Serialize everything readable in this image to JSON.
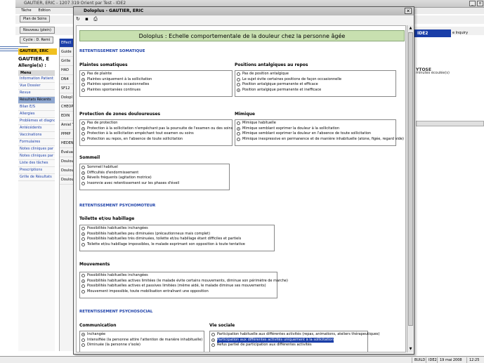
{
  "app": {
    "title": "GAUTIER, ERIC - 1207 319 Orient par Test - IDE2",
    "menu": [
      "Tâche",
      "Edition"
    ],
    "toolbar": {
      "plan_soins": "Plan de Soins",
      "nouveau": "Nouveau (plein)",
      "cycle": "Cycle : D. Remi"
    },
    "patient_bar": "GAUTIER, ERIC",
    "patient_name": "GAUTIER, E",
    "allergy": "Allergie(s) : ",
    "right_tab": "IDE2",
    "right_inquiry": "e Inquiry",
    "right_text1": "YTOSE",
    "right_text2": "minutes écoulée(s)"
  },
  "menu": {
    "title": "Menu",
    "items": [
      {
        "label": "Information Patient",
        "selected": false
      },
      {
        "label": "Vue Dossier",
        "selected": false
      },
      {
        "label": "Revue",
        "selected": false
      },
      {
        "label": "Résultats Récents",
        "selected": true
      },
      {
        "label": "Bilan E/S",
        "selected": false
      },
      {
        "label": "Allergies",
        "selected": false
      },
      {
        "label": "Problèmes et diagno",
        "selected": false
      },
      {
        "label": "Antécédents",
        "selected": false
      },
      {
        "label": "Vaccinations",
        "selected": false
      },
      {
        "label": "Formulaires",
        "selected": false
      },
      {
        "label": "Notes cliniques par",
        "selected": false
      },
      {
        "label": "Notes cliniques par t",
        "selected": false
      },
      {
        "label": "Liste des tâches",
        "selected": false
      },
      {
        "label": "Prescriptions",
        "selected": false
      },
      {
        "label": "Grille de Résultats",
        "selected": false
      }
    ]
  },
  "doc_list": [
    "Effect",
    "Guide",
    "Grille",
    "HAD",
    "DN4",
    "SF12",
    "Dolopl",
    "CHEOP",
    "EDIN",
    "Amiel T",
    "PPMP",
    "HEDEN",
    "Évalua",
    "Doulou",
    "Doulou",
    "Doulou"
  ],
  "dialog": {
    "title": "Doloplus - GAUTIER, ERIC",
    "banner": "Doloplus : Echelle comportementale de la douleur chez la personne âgée",
    "sections": {
      "somatique": "RETENTISSEMENT SOMATIQUE",
      "psychomoteur": "RETENTISSEMENT PSYCHOMOTEUR",
      "psychosocial": "RETENTISSEMENT PSYCHOSOCIAL"
    },
    "groups": {
      "plaintes": {
        "title": "Plaintes somatiques",
        "options": [
          {
            "label": "Pas de plainte",
            "selected": false
          },
          {
            "label": "Plaintes uniquement à la sollicitation",
            "selected": true
          },
          {
            "label": "Plaintes spontanées occasionnelles",
            "selected": false
          },
          {
            "label": "Plaintes spontanées continues",
            "selected": false
          }
        ]
      },
      "positions": {
        "title": "Positions antalgiques au repos",
        "options": [
          {
            "label": "Pas de position antalgique",
            "selected": false
          },
          {
            "label": "Le sujet évite certaines positions de façon occasionnelle",
            "selected": false
          },
          {
            "label": "Position antalgique permanente et efficace",
            "selected": false
          },
          {
            "label": "Position antalgique permanente et inefficace",
            "selected": true
          }
        ]
      },
      "protection": {
        "title": "Protection de zones douloureuses",
        "options": [
          {
            "label": "Pas de protection",
            "selected": false
          },
          {
            "label": "Protection à la sollicitation n'empêchant pas la poursuite de l'examen ou des soins",
            "selected": true
          },
          {
            "label": "Protection à la sollicitation empêchant tout examen ou soins",
            "selected": false
          },
          {
            "label": "Protection au repos, en l'absence de toute sollicitation",
            "selected": false
          }
        ]
      },
      "mimique": {
        "title": "Mimique",
        "options": [
          {
            "label": "Mimique habituelle",
            "selected": false
          },
          {
            "label": "Mimique semblant exprimer la douleur à la sollicitation",
            "selected": true
          },
          {
            "label": "Mimique semblant exprimer la douleur en l'absence de toute sollicitation",
            "selected": false
          },
          {
            "label": "Mimique inexpressive en permanence et de manière inhabituelle (atone, figée, regard vide)",
            "selected": false
          }
        ]
      },
      "sommeil": {
        "title": "Sommeil",
        "options": [
          {
            "label": "Sommeil habituel",
            "selected": false
          },
          {
            "label": "Difficultés d'endormissement",
            "selected": true
          },
          {
            "label": "Réveils fréquents (agitation motrice)",
            "selected": false
          },
          {
            "label": "Insomnie avec retentissement sur les phases d'éveil",
            "selected": false
          }
        ]
      },
      "toilette": {
        "title": "Toilette et/ou habillage",
        "options": [
          {
            "label": "Possibilités habituelles inchangées",
            "selected": false
          },
          {
            "label": "Possibilités habituelles peu diminuées (précautionneux mais complet)",
            "selected": true
          },
          {
            "label": "Possibilités habituelles très diminuées, toilette et/ou habillage étant difficiles et partiels",
            "selected": false
          },
          {
            "label": "Toilette et/ou habillage impossibles, le malade exprimant son opposition à toute tentative",
            "selected": false
          }
        ]
      },
      "mouvements": {
        "title": "Mouvements",
        "options": [
          {
            "label": "Possibilités habituelles inchangées",
            "selected": false
          },
          {
            "label": "Possibilités habituelles actives limitées (le malade évite certains mouvements, diminue son périmètre de marche)",
            "selected": true
          },
          {
            "label": "Possibilités habituelles actives et passives limitées (même aidé, le malade diminue ses mouvements)",
            "selected": false
          },
          {
            "label": "Mouvement impossible, toute mobilisation entraînant une opposition",
            "selected": false
          }
        ]
      },
      "communication": {
        "title": "Communication",
        "options": [
          {
            "label": "Inchangée",
            "selected": true
          },
          {
            "label": "Intensifiée (la personne attire l'attention de manière inhabituelle)",
            "selected": false
          },
          {
            "label": "Diminuée (la personne s'isole)",
            "selected": false
          }
        ]
      },
      "vie_sociale": {
        "title": "Vie sociale",
        "options": [
          {
            "label": "Participation habituelle aux différentes activités (repas, animations, ateliers thérapeutiques)",
            "selected": false
          },
          {
            "label": "Participation aux différentes activités uniquement à la sollicitation",
            "selected": true,
            "highlight": true
          },
          {
            "label": "Refus partiel de participation aux différentes activités",
            "selected": false
          }
        ]
      }
    }
  },
  "status": {
    "build": "BUILD",
    "user": "IDE2",
    "date": "19 mai 2008",
    "time": "12:25"
  }
}
